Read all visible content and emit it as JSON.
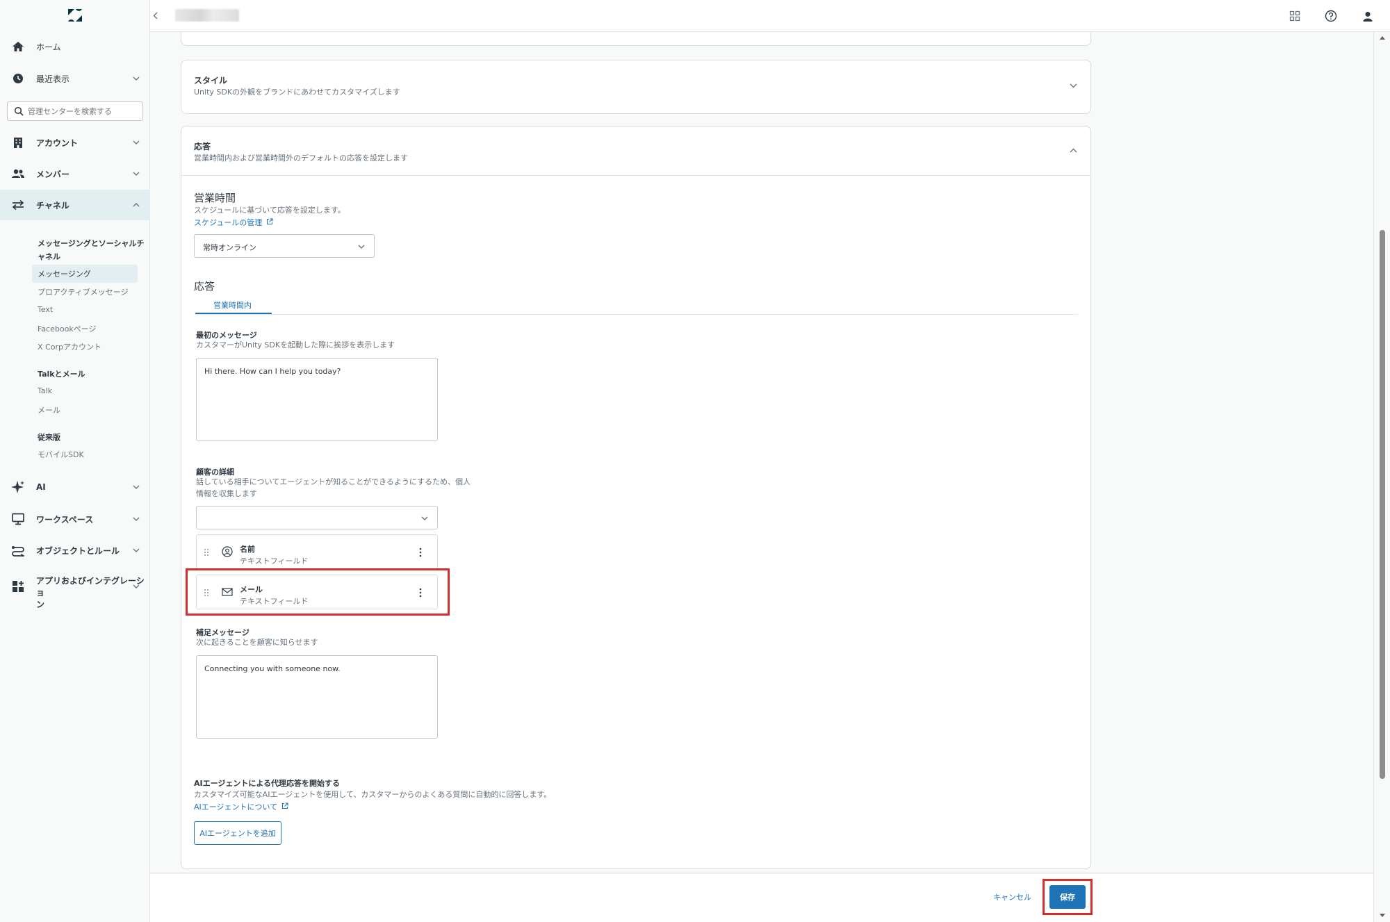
{
  "sidebar": {
    "nav": {
      "home": "ホーム",
      "recent": "最近表示",
      "account": "アカウント",
      "members": "メンバー",
      "channels": "チャネル",
      "ai": "AI",
      "workspaces": "ワークスペース",
      "objects": "オブジェクトとルール",
      "apps_line1": "アプリおよびインテグレーショ",
      "apps_line2": "ン"
    },
    "search_placeholder": "管理センターを検索する",
    "channels_sub": {
      "group1_head_line1": "メッセージングとソーシャルチ",
      "group1_head_line2": "ャネル",
      "messaging": "メッセージング",
      "proactive": "プロアクティブメッセージ",
      "text": "Text",
      "facebook": "Facebookページ",
      "xcorp": "X Corpアカウント",
      "group2_head": "Talkとメール",
      "talk": "Talk",
      "mail": "メール",
      "group3_head": "従来版",
      "mobile_sdk": "モバイルSDK"
    }
  },
  "style_card": {
    "title": "スタイル",
    "desc": "Unity SDKの外観をブランドにあわせてカスタマイズします"
  },
  "response_card": {
    "title": "応答",
    "desc": "営業時間内および営業時間外のデフォルトの応答を設定します",
    "business_hours": {
      "heading": "営業時間",
      "hint": "スケジュールに基づいて応答を設定します。",
      "link": "スケジュールの管理",
      "selected": "常時オンライン"
    },
    "responses_heading": "応答",
    "tab_in_hours": "営業時間内",
    "first_message": {
      "label": "最初のメッセージ",
      "hint": "カスタマーがUnity SDKを起動した際に挨拶を表示します",
      "value": "Hi there. How can I help you today?"
    },
    "customer_details": {
      "label": "顧客の詳細",
      "hint_line1": "話している相手についてエージェントが知ることができるようにするため、個人",
      "hint_line2": "情報を収集します",
      "fields": [
        {
          "name": "名前",
          "type": "テキストフィールド",
          "icon": "person-icon"
        },
        {
          "name": "メール",
          "type": "テキストフィールド",
          "icon": "mail-icon"
        }
      ]
    },
    "followup": {
      "label": "補足メッセージ",
      "hint": "次に起きることを顧客に知らせます",
      "value": "Connecting you with someone now."
    },
    "ai_agent": {
      "label": "AIエージェントによる代理応答を開始する",
      "hint": "カスタマイズ可能なAIエージェントを使用して、カスタマーからのよくある質問に自動的に回答します。",
      "link": "AIエージェントについて",
      "button": "AIエージェントを追加"
    }
  },
  "footer": {
    "cancel": "キャンセル",
    "save": "保存"
  },
  "colors": {
    "accent": "#1f73b7",
    "highlight": "#d32f2f",
    "active_nav": "#e3eef0"
  }
}
